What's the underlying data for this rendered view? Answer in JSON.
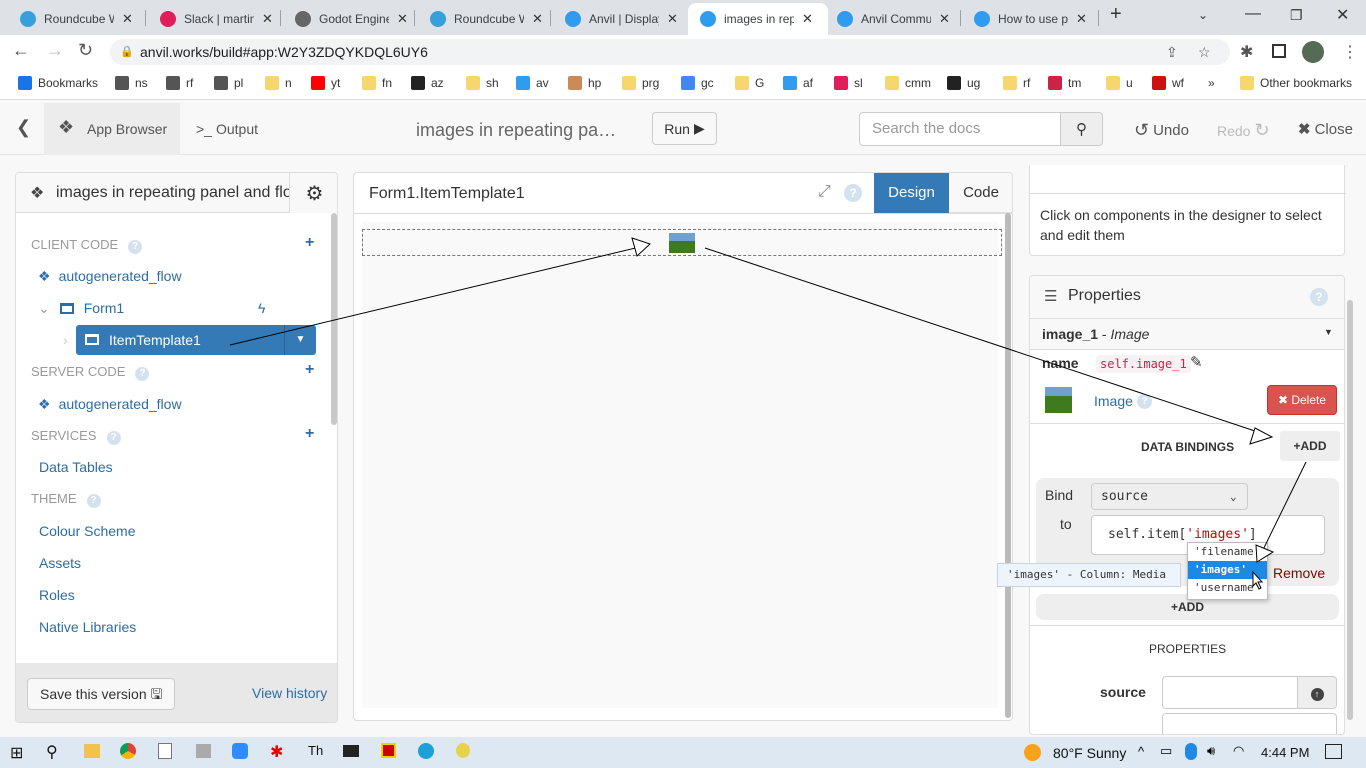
{
  "browser": {
    "tabs": [
      {
        "title": "Roundcube W",
        "icon": "roundcube-icon",
        "color": "#37a0da"
      },
      {
        "title": "Slack | martin",
        "icon": "slack-icon",
        "color": "#e01e5a"
      },
      {
        "title": "Godot Engine",
        "icon": "globe-icon",
        "color": "#555"
      },
      {
        "title": "Roundcube W",
        "icon": "roundcube-icon",
        "color": "#37a0da"
      },
      {
        "title": "Anvil | Display",
        "icon": "anvil-icon",
        "color": "#2f9cf0"
      },
      {
        "title": "images in rep",
        "icon": "anvil-icon",
        "color": "#2f9cf0",
        "active": true
      },
      {
        "title": "Anvil Commu",
        "icon": "anvil-icon",
        "color": "#2f9cf0"
      },
      {
        "title": "How to use p",
        "icon": "anvil-icon",
        "color": "#2f9cf0"
      }
    ],
    "url": "anvil.works/build#app:W2Y3ZDQYKDQL6UY6",
    "bookmarks": [
      {
        "label": "Bookmarks",
        "color": "#1a73e8"
      },
      {
        "label": "ns",
        "color": "#555"
      },
      {
        "label": "rf",
        "color": "#555"
      },
      {
        "label": "pl",
        "color": "#555"
      },
      {
        "label": "n",
        "color": "#f5d76e"
      },
      {
        "label": "yt",
        "color": "#ff0000"
      },
      {
        "label": "fn",
        "color": "#f5d76e"
      },
      {
        "label": "az",
        "color": "#222"
      },
      {
        "label": "sh",
        "color": "#f5d76e"
      },
      {
        "label": "av",
        "color": "#2f9cf0"
      },
      {
        "label": "hp",
        "color": "#c98b5a"
      },
      {
        "label": "prg",
        "color": "#f5d76e"
      },
      {
        "label": "gc",
        "color": "#4285f4"
      },
      {
        "label": "G",
        "color": "#f5d76e"
      },
      {
        "label": "af",
        "color": "#2f9cf0"
      },
      {
        "label": "sl",
        "color": "#e01e5a"
      },
      {
        "label": "cmm",
        "color": "#f5d76e"
      },
      {
        "label": "ug",
        "color": "#222"
      },
      {
        "label": "rf",
        "color": "#f5d76e"
      },
      {
        "label": "tm",
        "color": "#cc2244"
      },
      {
        "label": "u",
        "color": "#f5d76e"
      },
      {
        "label": "wf",
        "color": "#cc1111"
      }
    ],
    "overflow": "»",
    "other_bookmarks": "Other bookmarks"
  },
  "toolbar": {
    "app_browser": "App Browser",
    "output": "Output",
    "app_title": "images in repeating pa…",
    "run": "Run",
    "search_placeholder": "Search the docs",
    "undo": "Undo",
    "redo": "Redo",
    "close": "Close"
  },
  "left_panel": {
    "app_name": "images in repeating panel and flo",
    "sections": {
      "client_code": "CLIENT CODE",
      "server_code": "SERVER CODE",
      "services": "SERVICES",
      "theme": "THEME"
    },
    "client_items": [
      "autogenerated_flow",
      "Form1",
      "ItemTemplate1"
    ],
    "server_items": [
      "autogenerated_flow"
    ],
    "service_items": [
      "Data Tables"
    ],
    "theme_items": [
      "Colour Scheme",
      "Assets",
      "Roles",
      "Native Libraries"
    ],
    "save_version": "Save this version",
    "view_history": "View history"
  },
  "center": {
    "title": "Form1.ItemTemplate1",
    "design_tab": "Design",
    "code_tab": "Code"
  },
  "right": {
    "hint": "Click on components in the designer to select and edit them",
    "properties_title": "Properties",
    "component": "image_1",
    "component_type": "Image",
    "name_label": "name",
    "name_value": "self.image_1",
    "type_link": "Image",
    "delete": "Delete",
    "data_bindings": "DATA BINDINGS",
    "add": "ADD",
    "bind_label": "Bind",
    "to_label": "to",
    "bind_prop": "source",
    "bind_expr_prefix": "self.item[",
    "bind_expr_key": "'images'",
    "bind_expr_suffix": "]",
    "autocomplete": [
      "'filename'",
      "'images'",
      "'username'"
    ],
    "autocomplete_selected": 1,
    "tooltip": "'images' - Column: Media",
    "remove": "Remove",
    "properties_heading": "PROPERTIES",
    "source_label": "source",
    "source_value": ""
  },
  "taskbar": {
    "weather_temp": "80°F",
    "weather_text": "Sunny",
    "time": "4:44 PM"
  }
}
